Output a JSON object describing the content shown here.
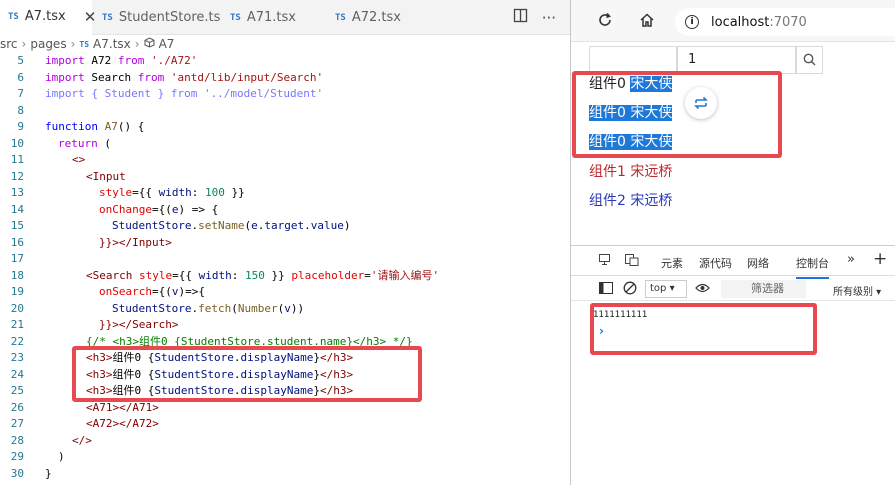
{
  "editor": {
    "tabs": [
      {
        "label": "A7.tsx",
        "active": true
      },
      {
        "label": "StudentStore.ts",
        "active": false
      },
      {
        "label": "A71.tsx",
        "active": false
      },
      {
        "label": "A72.tsx",
        "active": false
      }
    ],
    "close_glyph": "✕",
    "ts_badge": "TS",
    "breadcrumb": [
      "src",
      "pages",
      "A7.tsx",
      "A7"
    ],
    "lines": [
      {
        "n": "5"
      },
      {
        "n": "6"
      },
      {
        "n": "7"
      },
      {
        "n": "8"
      },
      {
        "n": "9"
      },
      {
        "n": "10"
      },
      {
        "n": "11"
      },
      {
        "n": "12"
      },
      {
        "n": "13"
      },
      {
        "n": "14"
      },
      {
        "n": "15"
      },
      {
        "n": "16"
      },
      {
        "n": "17"
      },
      {
        "n": "18"
      },
      {
        "n": "19"
      },
      {
        "n": "20"
      },
      {
        "n": "21"
      },
      {
        "n": "22"
      },
      {
        "n": "23"
      },
      {
        "n": "24"
      },
      {
        "n": "25"
      },
      {
        "n": "26"
      },
      {
        "n": "27"
      },
      {
        "n": "28"
      },
      {
        "n": "29"
      },
      {
        "n": "30"
      }
    ],
    "code": {
      "l5": [
        "import",
        " A72 ",
        "from",
        " './A72'"
      ],
      "l6": [
        "import",
        " Search ",
        "from",
        " 'antd/lib/input/Search'"
      ],
      "l7": "import { Student } from '../model/Student'",
      "l9": [
        "function",
        " A7",
        "() {"
      ],
      "l10": [
        "return",
        " ("
      ],
      "l11": "<>",
      "l12": "<Input",
      "l13": [
        "style",
        "={{ ",
        "width",
        ": ",
        "100",
        " }}"
      ],
      "l14": [
        "onChange",
        "={(",
        "e",
        ") => {"
      ],
      "l15": [
        "StudentStore",
        ".",
        "setName",
        "(",
        "e",
        ".",
        "target",
        ".",
        "value",
        ")"
      ],
      "l16": "}}></Input>",
      "l18": [
        "<Search",
        " style",
        "={{ ",
        "width",
        ": ",
        "150",
        " }} ",
        "placeholder",
        "=",
        "'请输入编号'"
      ],
      "l19": [
        "onSearch",
        "={(",
        "v",
        ")=>{"
      ],
      "l20": [
        "StudentStore",
        ".",
        "fetch",
        "(",
        "Number",
        "(",
        "v",
        "))"
      ],
      "l21": "}}></Search>",
      "l22": "{/* <h3>组件0 {StudentStore.student.name}</h3> */}",
      "l23": [
        "<h3>",
        "组件0 {",
        "StudentStore",
        ".",
        "displayName",
        "}",
        "</h3>"
      ],
      "l24": [
        "<h3>",
        "组件0 {",
        "StudentStore",
        ".",
        "displayName",
        "}",
        "</h3>"
      ],
      "l25": [
        "<h3>",
        "组件0 {",
        "StudentStore",
        ".",
        "displayName",
        "}",
        "</h3>"
      ],
      "l26": "<A71></A71>",
      "l27": "<A72></A72>",
      "l28": "</>",
      "l29": ")",
      "l30": "}"
    }
  },
  "browser": {
    "url_host": "localhost",
    "url_port": ":7070",
    "search_value": "1",
    "rows": [
      {
        "label": "组件0",
        "name": "宋大侠"
      },
      {
        "label": "组件0",
        "name": "宋大侠"
      },
      {
        "label": "组件0",
        "name": "宋大侠"
      },
      {
        "label": "组件1",
        "name": "宋远桥"
      },
      {
        "label": "组件2",
        "name": "宋远桥"
      }
    ],
    "devtools": {
      "tabs": [
        "元素",
        "源代码",
        "网络",
        "控制台"
      ],
      "context": "top",
      "filter_placeholder": "筛选器",
      "levels": "所有级别",
      "log": "1111111111",
      "prompt": "›"
    }
  },
  "colors": {
    "highlight_box": "#e8484f",
    "selection": "#1e78d7",
    "component1": "#c0282e",
    "component2": "#2a3bb8"
  }
}
